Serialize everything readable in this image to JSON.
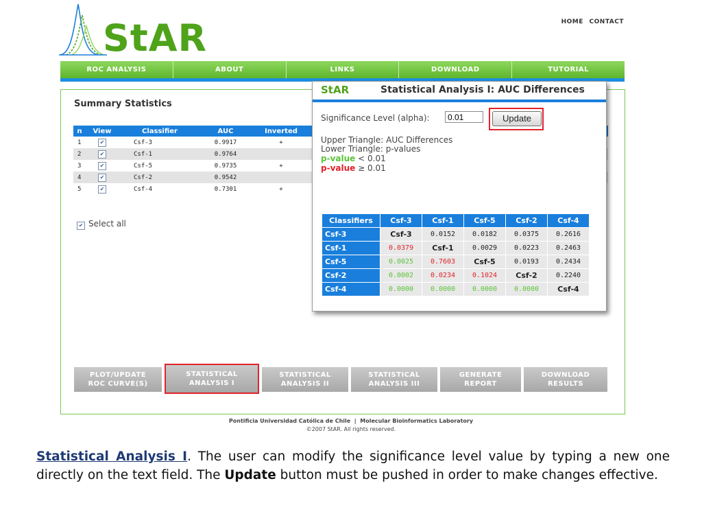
{
  "header": {
    "logo_text": "StAR",
    "top_links": [
      "HOME",
      "CONTACT"
    ]
  },
  "nav": [
    "ROC ANALYSIS",
    "ABOUT",
    "LINKS",
    "DOWNLOAD",
    "TUTORIAL"
  ],
  "summary": {
    "title": "Summary Statistics",
    "columns": [
      "n",
      "View",
      "Classifier",
      "AUC",
      "Inverted"
    ],
    "rows": [
      {
        "n": "1",
        "classifier": "Csf-3",
        "auc": "0.9917",
        "inverted": "+"
      },
      {
        "n": "2",
        "classifier": "Csf-1",
        "auc": "0.9764",
        "inverted": ""
      },
      {
        "n": "3",
        "classifier": "Csf-5",
        "auc": "0.9735",
        "inverted": "+"
      },
      {
        "n": "4",
        "classifier": "Csf-2",
        "auc": "0.9542",
        "inverted": ""
      },
      {
        "n": "5",
        "classifier": "Csf-4",
        "auc": "0.7301",
        "inverted": "+"
      }
    ],
    "select_all": "Select all"
  },
  "popup": {
    "brand": "StAR",
    "title": "Statistical Analysis I: AUC Differences",
    "alpha_label": "Significance Level (alpha):",
    "alpha_value": "0.01",
    "update_label": "Update",
    "legend_upper": "Upper Triangle: AUC Differences",
    "legend_lower": "Lower Triangle: p-values",
    "legend_pvalue_word": "p-value",
    "legend_lt": "< 0.01",
    "legend_ge": "≥ 0.01",
    "matrix": {
      "corner": "Classifiers",
      "headers": [
        "Csf-3",
        "Csf-1",
        "Csf-5",
        "Csf-2",
        "Csf-4"
      ],
      "rows": [
        {
          "label": "Csf-3",
          "cells": [
            "Csf-3",
            "0.0152",
            "0.0182",
            "0.0375",
            "0.2616"
          ]
        },
        {
          "label": "Csf-1",
          "cells": [
            "0.0379",
            "Csf-1",
            "0.0029",
            "0.0223",
            "0.2463"
          ]
        },
        {
          "label": "Csf-5",
          "cells": [
            "0.0025",
            "0.7603",
            "Csf-5",
            "0.0193",
            "0.2434"
          ]
        },
        {
          "label": "Csf-2",
          "cells": [
            "0.0002",
            "0.0234",
            "0.1024",
            "Csf-2",
            "0.2240"
          ]
        },
        {
          "label": "Csf-4",
          "cells": [
            "0.0000",
            "0.0000",
            "0.0000",
            "0.0000",
            "Csf-4"
          ]
        }
      ],
      "colors": {
        "significant": "#5cc33a",
        "not_significant": "#e2222a"
      }
    }
  },
  "buttons": [
    {
      "line1": "PLOT/UPDATE",
      "line2": "ROC CURVE(S)"
    },
    {
      "line1": "STATISTICAL",
      "line2": "ANALYSIS I"
    },
    {
      "line1": "STATISTICAL",
      "line2": "ANALYSIS II"
    },
    {
      "line1": "STATISTICAL",
      "line2": "ANALYSIS III"
    },
    {
      "line1": "GENERATE",
      "line2": "REPORT"
    },
    {
      "line1": "DOWNLOAD",
      "line2": "RESULTS"
    }
  ],
  "footer": {
    "institution": "Pontificia Universidad Católica de Chile",
    "separator": "|",
    "lab": "Molecular Bioinformatics Laboratory",
    "copyright": "©2007 StAR. All rights reserved."
  },
  "caption": {
    "title": "Statistical Analysis I",
    "text1": ". The user can modify the significance level value by typing a new one directly on the text field. The ",
    "bold": "Update",
    "text2": " button must be pushed in order to make changes effective."
  }
}
